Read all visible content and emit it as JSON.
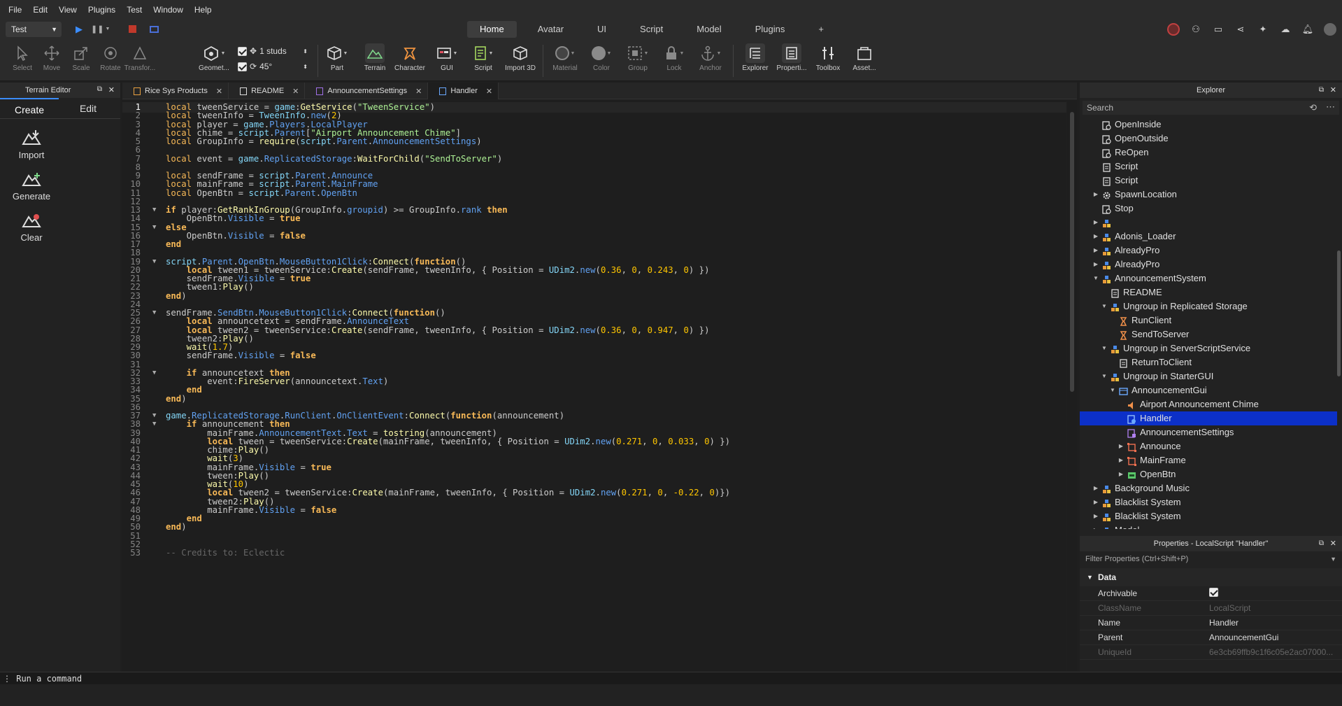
{
  "menu": [
    "File",
    "Edit",
    "View",
    "Plugins",
    "Test",
    "Window",
    "Help"
  ],
  "play_mode": "Test",
  "top_tabs": [
    {
      "label": "Home",
      "active": true
    },
    {
      "label": "Avatar"
    },
    {
      "label": "UI"
    },
    {
      "label": "Script"
    },
    {
      "label": "Model"
    },
    {
      "label": "Plugins"
    },
    {
      "label": "+"
    }
  ],
  "ribbon": {
    "tools": [
      "Select",
      "Move",
      "Scale",
      "Rotate",
      "Transfor...",
      "Geomet...",
      "Part",
      "Terrain",
      "Character",
      "GUI",
      "Script",
      "Import 3D",
      "Material",
      "Color",
      "Group",
      "Lock",
      "Anchor",
      "Explorer",
      "Properti...",
      "Toolbox",
      "Asset..."
    ],
    "studs": "1 studs",
    "angle": "45°"
  },
  "terrain_editor": {
    "title": "Terrain Editor",
    "tabs": [
      "Create",
      "Edit"
    ],
    "actions": [
      "Import",
      "Generate",
      "Clear"
    ]
  },
  "editor_tabs": [
    {
      "label": "Rice Sys Products",
      "icon": "model-icon"
    },
    {
      "label": "README",
      "icon": "doc-icon"
    },
    {
      "label": "AnnouncementSettings",
      "icon": "module-icon"
    },
    {
      "label": "Handler",
      "icon": "localscript-icon",
      "active": true
    }
  ],
  "code_lines": [
    {
      "n": "1",
      "fold": false,
      "html": "<span class=\"kwl\">local</span> tweenService = <span class=\"gb\">game</span>:<span class=\"fn\">GetService</span>(<span class=\"st\">\"TweenService\"</span>)"
    },
    {
      "n": "2",
      "fold": false,
      "html": "<span class=\"kwl\">local</span> tweenInfo = <span class=\"gb\">TweenInfo</span>.<span class=\"pr\">new</span>(<span class=\"nm\">2</span>)"
    },
    {
      "n": "3",
      "fold": false,
      "html": "<span class=\"kwl\">local</span> player = <span class=\"gb\">game</span>.<span class=\"pr\">Players</span>.<span class=\"pr\">LocalPlayer</span>"
    },
    {
      "n": "4",
      "fold": false,
      "html": "<span class=\"kwl\">local</span> chime = <span class=\"gb\">script</span>.<span class=\"pr\">Parent</span>[<span class=\"st\">\"Airport Announcement Chime\"</span>]"
    },
    {
      "n": "5",
      "fold": false,
      "html": "<span class=\"kwl\">local</span> GroupInfo = <span class=\"fn\">require</span>(<span class=\"gb\">script</span>.<span class=\"pr\">Parent</span>.<span class=\"pr\">AnnouncementSettings</span>)"
    },
    {
      "n": "6",
      "fold": false,
      "html": ""
    },
    {
      "n": "7",
      "fold": false,
      "html": "<span class=\"kwl\">local</span> event = <span class=\"gb\">game</span>.<span class=\"pr\">ReplicatedStorage</span>:<span class=\"fn\">WaitForChild</span>(<span class=\"st\">\"SendToServer\"</span>)"
    },
    {
      "n": "8",
      "fold": false,
      "html": ""
    },
    {
      "n": "9",
      "fold": false,
      "html": "<span class=\"kwl\">local</span> sendFrame = <span class=\"gb\">script</span>.<span class=\"pr\">Parent</span>.<span class=\"pr\">Announce</span>"
    },
    {
      "n": "10",
      "fold": false,
      "html": "<span class=\"kwl\">local</span> mainFrame = <span class=\"gb\">script</span>.<span class=\"pr\">Parent</span>.<span class=\"pr\">MainFrame</span>"
    },
    {
      "n": "11",
      "fold": false,
      "html": "<span class=\"kwl\">local</span> OpenBtn = <span class=\"gb\">script</span>.<span class=\"pr\">Parent</span>.<span class=\"pr\">OpenBtn</span>"
    },
    {
      "n": "12",
      "fold": false,
      "html": ""
    },
    {
      "n": "13",
      "fold": true,
      "html": "<span class=\"kw\">if</span> player:<span class=\"fn\">GetRankInGroup</span>(GroupInfo.<span class=\"pr\">groupid</span>) >= GroupInfo.<span class=\"pr\">rank</span> <span class=\"kw\">then</span>"
    },
    {
      "n": "14",
      "fold": false,
      "html": "    OpenBtn.<span class=\"pr\">Visible</span> = <span class=\"kw\">true</span>"
    },
    {
      "n": "15",
      "fold": true,
      "html": "<span class=\"kw\">else</span>"
    },
    {
      "n": "16",
      "fold": false,
      "html": "    OpenBtn.<span class=\"pr\">Visible</span> = <span class=\"kw\">false</span>"
    },
    {
      "n": "17",
      "fold": false,
      "html": "<span class=\"kw\">end</span>"
    },
    {
      "n": "18",
      "fold": false,
      "html": ""
    },
    {
      "n": "19",
      "fold": true,
      "html": "<span class=\"gb\">script</span>.<span class=\"pr\">Parent</span>.<span class=\"pr\">OpenBtn</span>.<span class=\"pr\">MouseButton1Click</span>:<span class=\"fn\">Connect</span>(<span class=\"kw\">function</span>()"
    },
    {
      "n": "20",
      "fold": false,
      "html": "    <span class=\"kw\">local</span> tween1 = tweenService:<span class=\"fn\">Create</span>(sendFrame, tweenInfo, { Position = <span class=\"gb\">UDim2</span>.<span class=\"pr\">new</span>(<span class=\"nm\">0.36</span>, <span class=\"nm\">0</span>, <span class=\"nm\">0.243</span>, <span class=\"nm\">0</span>) })"
    },
    {
      "n": "21",
      "fold": false,
      "html": "    sendFrame.<span class=\"pr\">Visible</span> = <span class=\"kw\">true</span>"
    },
    {
      "n": "22",
      "fold": false,
      "html": "    tween1:<span class=\"fn\">Play</span>()"
    },
    {
      "n": "23",
      "fold": false,
      "html": "<span class=\"kw\">end</span>)"
    },
    {
      "n": "24",
      "fold": false,
      "html": ""
    },
    {
      "n": "25",
      "fold": true,
      "html": "sendFrame.<span class=\"pr\">SendBtn</span>.<span class=\"pr\">MouseButton1Click</span>:<span class=\"fn\">Connect</span>(<span class=\"kw\">function</span>()"
    },
    {
      "n": "26",
      "fold": false,
      "html": "    <span class=\"kw\">local</span> announcetext = sendFrame.<span class=\"pr\">AnnounceText</span>"
    },
    {
      "n": "27",
      "fold": false,
      "html": "    <span class=\"kw\">local</span> tween2 = tweenService:<span class=\"fn\">Create</span>(sendFrame, tweenInfo, { Position = <span class=\"gb\">UDim2</span>.<span class=\"pr\">new</span>(<span class=\"nm\">0.36</span>, <span class=\"nm\">0</span>, <span class=\"nm\">0.947</span>, <span class=\"nm\">0</span>) })"
    },
    {
      "n": "28",
      "fold": false,
      "html": "    tween2:<span class=\"fn\">Play</span>()"
    },
    {
      "n": "29",
      "fold": false,
      "html": "    <span class=\"fn\">wait</span>(<span class=\"nm\">1.7</span>)"
    },
    {
      "n": "30",
      "fold": false,
      "html": "    sendFrame.<span class=\"pr\">Visible</span> = <span class=\"kw\">false</span>"
    },
    {
      "n": "31",
      "fold": false,
      "html": ""
    },
    {
      "n": "32",
      "fold": true,
      "html": "    <span class=\"kw\">if</span> announcetext <span class=\"kw\">then</span>"
    },
    {
      "n": "33",
      "fold": false,
      "html": "        event:<span class=\"fn\">FireServer</span>(announcetext.<span class=\"pr\">Text</span>)"
    },
    {
      "n": "34",
      "fold": false,
      "html": "    <span class=\"kw\">end</span>"
    },
    {
      "n": "35",
      "fold": false,
      "html": "<span class=\"kw\">end</span>)"
    },
    {
      "n": "36",
      "fold": false,
      "html": ""
    },
    {
      "n": "37",
      "fold": true,
      "html": "<span class=\"gb\">game</span>.<span class=\"pr\">ReplicatedStorage</span>.<span class=\"pr\">RunClient</span>.<span class=\"pr\">OnClientEvent</span>:<span class=\"fn\">Connect</span>(<span class=\"kw\">function</span>(announcement)"
    },
    {
      "n": "38",
      "fold": true,
      "html": "    <span class=\"kw\">if</span> announcement <span class=\"kw\">then</span>"
    },
    {
      "n": "39",
      "fold": false,
      "html": "        mainFrame.<span class=\"pr\">AnnouncementText</span>.<span class=\"pr\">Text</span> = <span class=\"fn\">tostring</span>(announcement)"
    },
    {
      "n": "40",
      "fold": false,
      "html": "        <span class=\"kw\">local</span> tween = tweenService:<span class=\"fn\">Create</span>(mainFrame, tweenInfo, { Position = <span class=\"gb\">UDim2</span>.<span class=\"pr\">new</span>(<span class=\"nm\">0.271</span>, <span class=\"nm\">0</span>, <span class=\"nm\">0.033</span>, <span class=\"nm\">0</span>) })"
    },
    {
      "n": "41",
      "fold": false,
      "html": "        chime:<span class=\"fn\">Play</span>()"
    },
    {
      "n": "42",
      "fold": false,
      "html": "        <span class=\"fn\">wait</span>(<span class=\"nm\">3</span>)"
    },
    {
      "n": "43",
      "fold": false,
      "html": "        mainFrame.<span class=\"pr\">Visible</span> = <span class=\"kw\">true</span>"
    },
    {
      "n": "44",
      "fold": false,
      "html": "        tween:<span class=\"fn\">Play</span>()"
    },
    {
      "n": "45",
      "fold": false,
      "html": "        <span class=\"fn\">wait</span>(<span class=\"nm\">10</span>)"
    },
    {
      "n": "46",
      "fold": false,
      "html": "        <span class=\"kw\">local</span> tween2 = tweenService:<span class=\"fn\">Create</span>(mainFrame, tweenInfo, { Position = <span class=\"gb\">UDim2</span>.<span class=\"pr\">new</span>(<span class=\"nm\">0.271</span>, <span class=\"nm\">0</span>, <span class=\"nm\">-0.22</span>, <span class=\"nm\">0</span>)})"
    },
    {
      "n": "47",
      "fold": false,
      "html": "        tween2:<span class=\"fn\">Play</span>()"
    },
    {
      "n": "48",
      "fold": false,
      "html": "        mainFrame.<span class=\"pr\">Visible</span> = <span class=\"kw\">false</span>"
    },
    {
      "n": "49",
      "fold": false,
      "html": "    <span class=\"kw\">end</span>"
    },
    {
      "n": "50",
      "fold": false,
      "html": "<span class=\"kw\">end</span>)"
    },
    {
      "n": "51",
      "fold": false,
      "html": ""
    },
    {
      "n": "52",
      "fold": false,
      "html": ""
    },
    {
      "n": "53",
      "fold": false,
      "html": "<span class=\"cm\">-- Credits to: Eclectic</span>"
    }
  ],
  "explorer": {
    "title": "Explorer",
    "search_placeholder": "Search",
    "items": [
      {
        "label": "OpenInside",
        "depth": 1,
        "icon": "script-icon",
        "arrow": ""
      },
      {
        "label": "OpenOutside",
        "depth": 1,
        "icon": "script-icon",
        "arrow": ""
      },
      {
        "label": "ReOpen",
        "depth": 1,
        "icon": "script-icon",
        "arrow": ""
      },
      {
        "label": "Script",
        "depth": 1,
        "icon": "doc-icon",
        "arrow": ""
      },
      {
        "label": "Script",
        "depth": 1,
        "icon": "doc-icon",
        "arrow": ""
      },
      {
        "label": "SpawnLocation",
        "depth": 1,
        "icon": "gear-icon",
        "arrow": "right"
      },
      {
        "label": "Stop",
        "depth": 1,
        "icon": "script-icon",
        "arrow": ""
      },
      {
        "label": "",
        "depth": 1,
        "icon": "model-icon",
        "arrow": "right"
      },
      {
        "label": "Adonis_Loader",
        "depth": 1,
        "icon": "model-icon",
        "arrow": "right"
      },
      {
        "label": "AlreadyPro",
        "depth": 1,
        "icon": "model-icon",
        "arrow": "right"
      },
      {
        "label": "AlreadyPro",
        "depth": 1,
        "icon": "model-icon",
        "arrow": "right"
      },
      {
        "label": "AnnouncementSystem",
        "depth": 1,
        "icon": "model-icon",
        "arrow": "down"
      },
      {
        "label": "README",
        "depth": 2,
        "icon": "doc-icon",
        "arrow": ""
      },
      {
        "label": "Ungroup in Replicated Storage",
        "depth": 2,
        "icon": "model-icon",
        "arrow": "down"
      },
      {
        "label": "RunClient",
        "depth": 3,
        "icon": "remote-icon",
        "arrow": ""
      },
      {
        "label": "SendToServer",
        "depth": 3,
        "icon": "remote-icon",
        "arrow": ""
      },
      {
        "label": "Ungroup in ServerScriptService",
        "depth": 2,
        "icon": "model-icon",
        "arrow": "down"
      },
      {
        "label": "ReturnToClient",
        "depth": 3,
        "icon": "doc-icon",
        "arrow": ""
      },
      {
        "label": "Ungroup in StarterGUI",
        "depth": 2,
        "icon": "model-icon",
        "arrow": "down"
      },
      {
        "label": "AnnouncementGui",
        "depth": 3,
        "icon": "gui-icon",
        "arrow": "down"
      },
      {
        "label": "Airport Announcement Chime",
        "depth": 4,
        "icon": "sound-icon",
        "arrow": ""
      },
      {
        "label": "Handler",
        "depth": 4,
        "icon": "localscript-icon",
        "arrow": "",
        "selected": true
      },
      {
        "label": "AnnouncementSettings",
        "depth": 4,
        "icon": "module-icon",
        "arrow": ""
      },
      {
        "label": "Announce",
        "depth": 4,
        "icon": "frame-icon",
        "arrow": "right"
      },
      {
        "label": "MainFrame",
        "depth": 4,
        "icon": "frame-icon",
        "arrow": "right"
      },
      {
        "label": "OpenBtn",
        "depth": 4,
        "icon": "button-icon",
        "arrow": "right"
      },
      {
        "label": "Background Music",
        "depth": 1,
        "icon": "model-icon",
        "arrow": "right"
      },
      {
        "label": "Blacklist System",
        "depth": 1,
        "icon": "model-icon",
        "arrow": "right"
      },
      {
        "label": "Blacklist System",
        "depth": 1,
        "icon": "model-icon",
        "arrow": "right"
      },
      {
        "label": "Model",
        "depth": 1,
        "icon": "model-icon",
        "arrow": "right"
      }
    ]
  },
  "properties": {
    "title": "Properties - LocalScript \"Handler\"",
    "filter_placeholder": "Filter Properties (Ctrl+Shift+P)",
    "section": "Data",
    "rows": [
      {
        "key": "Archivable",
        "value": "",
        "checkbox": true
      },
      {
        "key": "ClassName",
        "value": "LocalScript",
        "dim": true
      },
      {
        "key": "Name",
        "value": "Handler"
      },
      {
        "key": "Parent",
        "value": "AnnouncementGui"
      },
      {
        "key": "UniqueId",
        "value": "6e3cb69ffb9c1f6c05e2ac07000...",
        "dim": true
      }
    ]
  },
  "command_bar": {
    "placeholder": "Run a command"
  }
}
